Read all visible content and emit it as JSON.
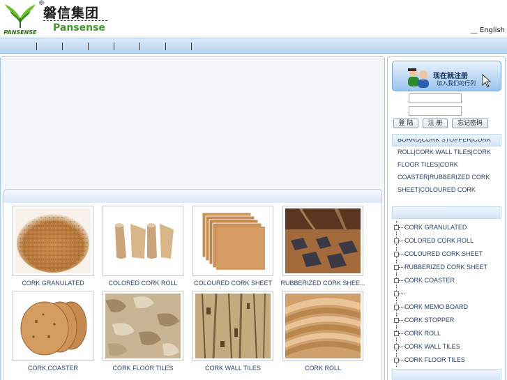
{
  "header": {
    "logo_reg_mark": "®",
    "logo_cn": "磐信集团",
    "logo_en": "Pansense",
    "logo_mark_text": "PANSENSE",
    "language_link": "English"
  },
  "colors": {
    "nav_bar": "#c6dcf3",
    "brand_green": "#3f9b2a",
    "link_text": "#2a3f66"
  },
  "products": [
    {
      "label": "CORK GRANULATED",
      "image": "cork-granules"
    },
    {
      "label": "COLORED CORK ROLL",
      "image": "cork-rolls"
    },
    {
      "label": "COLOURED CORK SHEET",
      "image": "cork-sheets"
    },
    {
      "label": "RUBBERIZED CORK SHEE...",
      "image": "rubberized-floor"
    },
    {
      "label": "CORK COASTER",
      "image": "cork-coasters"
    },
    {
      "label": "CORK FLOOR TILES",
      "image": "cork-floor-tile"
    },
    {
      "label": "CORK WALL TILES",
      "image": "cork-wall-tile"
    },
    {
      "label": "CORK ROLL",
      "image": "cork-roll"
    }
  ],
  "sidebar": {
    "register_title": "现在就注册",
    "register_subtitle": "加入我们的行列",
    "username_value": "",
    "password_value": "",
    "login_button": "登 陆",
    "register_button": "注 册",
    "forgot_button": "忘记密码",
    "keywords": [
      "BOARD|CORK STOPPER|CORK",
      "ROLL|CORK WALL TILES|CORK",
      "FLOOR TILES|CORK",
      "COASTER|RUBBERIZED CORK",
      "SHEET|COLOURED CORK"
    ],
    "categories": [
      "CORK GRANULATED",
      "COLORED CORK ROLL",
      "COLOURED CORK SHEET",
      "RUBBERIZED CORK SHEET",
      "CORK COASTER",
      "",
      "CORK MEMO BOARD",
      "CORK STOPPER",
      "CORK ROLL",
      "CORK WALL TILES",
      "CORK FLOOR TILES"
    ]
  }
}
